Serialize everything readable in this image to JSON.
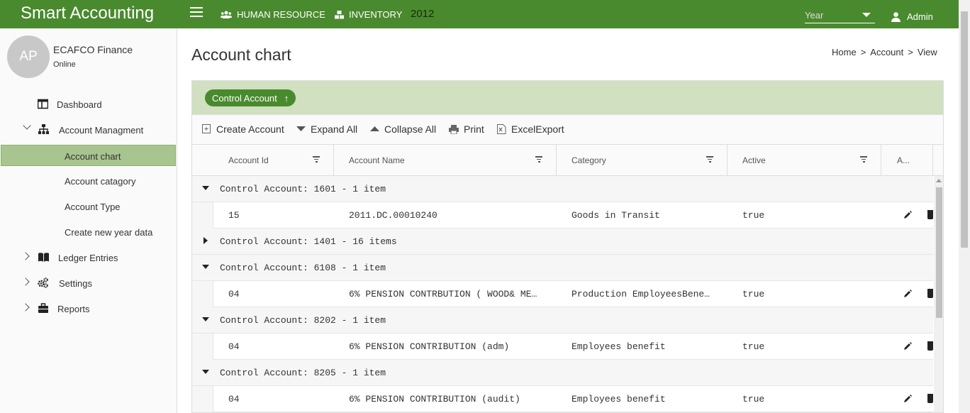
{
  "app": {
    "brand": "Smart Accounting",
    "year_value": "2012"
  },
  "topnav": {
    "human_resource": "HUMAN RESOURCE",
    "inventory": "INVENTORY",
    "year_placeholder": "Year",
    "admin": "Admin"
  },
  "user": {
    "initials": "AP",
    "name": "ECAFCO Finance",
    "status": "Online"
  },
  "sidebar": {
    "items": [
      {
        "label": "Dashboard"
      },
      {
        "label": "Account Managment"
      },
      {
        "label": "Account chart"
      },
      {
        "label": "Account catagory"
      },
      {
        "label": "Account Type"
      },
      {
        "label": "Create new year data"
      },
      {
        "label": "Ledger Entries"
      },
      {
        "label": "Settings"
      },
      {
        "label": "Reports"
      }
    ]
  },
  "page": {
    "title": "Account chart"
  },
  "breadcrumb": {
    "home": "Home",
    "sep": ">",
    "account": "Account",
    "view": "View"
  },
  "grid": {
    "group_chip": "Control Account",
    "group_chip_sort": "↑",
    "toolbar": {
      "create": "Create Account",
      "expand": "Expand All",
      "collapse": "Collapse All",
      "print": "Print",
      "excel": "ExcelExport"
    },
    "columns": [
      "Account Id",
      "Account Name",
      "Category",
      "Active",
      "A..."
    ],
    "rows": [
      {
        "type": "group",
        "text": "Control Account: 1601 - 1 item",
        "expanded": true
      },
      {
        "type": "data",
        "id": "15",
        "name": "2011.DC.00010240",
        "category": "Goods in Transit",
        "active": "true"
      },
      {
        "type": "group",
        "text": "Control Account: 1401 - 16 items",
        "expanded": false
      },
      {
        "type": "group",
        "text": "Control Account: 6108 - 1 item",
        "expanded": true
      },
      {
        "type": "data",
        "id": "04",
        "name": "6% PENSION CONTRBUTION ( WOOD& ME…",
        "category": "Production EmployeesBene…",
        "active": "true"
      },
      {
        "type": "group",
        "text": "Control Account: 8202 - 1 item",
        "expanded": true
      },
      {
        "type": "data",
        "id": "04",
        "name": "6% PENSION CONTRIBUTION (adm)",
        "category": "Employees benefit",
        "active": "true"
      },
      {
        "type": "group",
        "text": "Control Account: 8205 - 1 item",
        "expanded": true
      },
      {
        "type": "data",
        "id": "04",
        "name": "6% PENSION CONTRIBUTION (audit)",
        "category": "Employees benefit",
        "active": "true"
      }
    ]
  },
  "colors": {
    "brand_green": "#4a8a2e",
    "active_item": "#a8c48f",
    "group_panel": "#d0e0c0"
  }
}
